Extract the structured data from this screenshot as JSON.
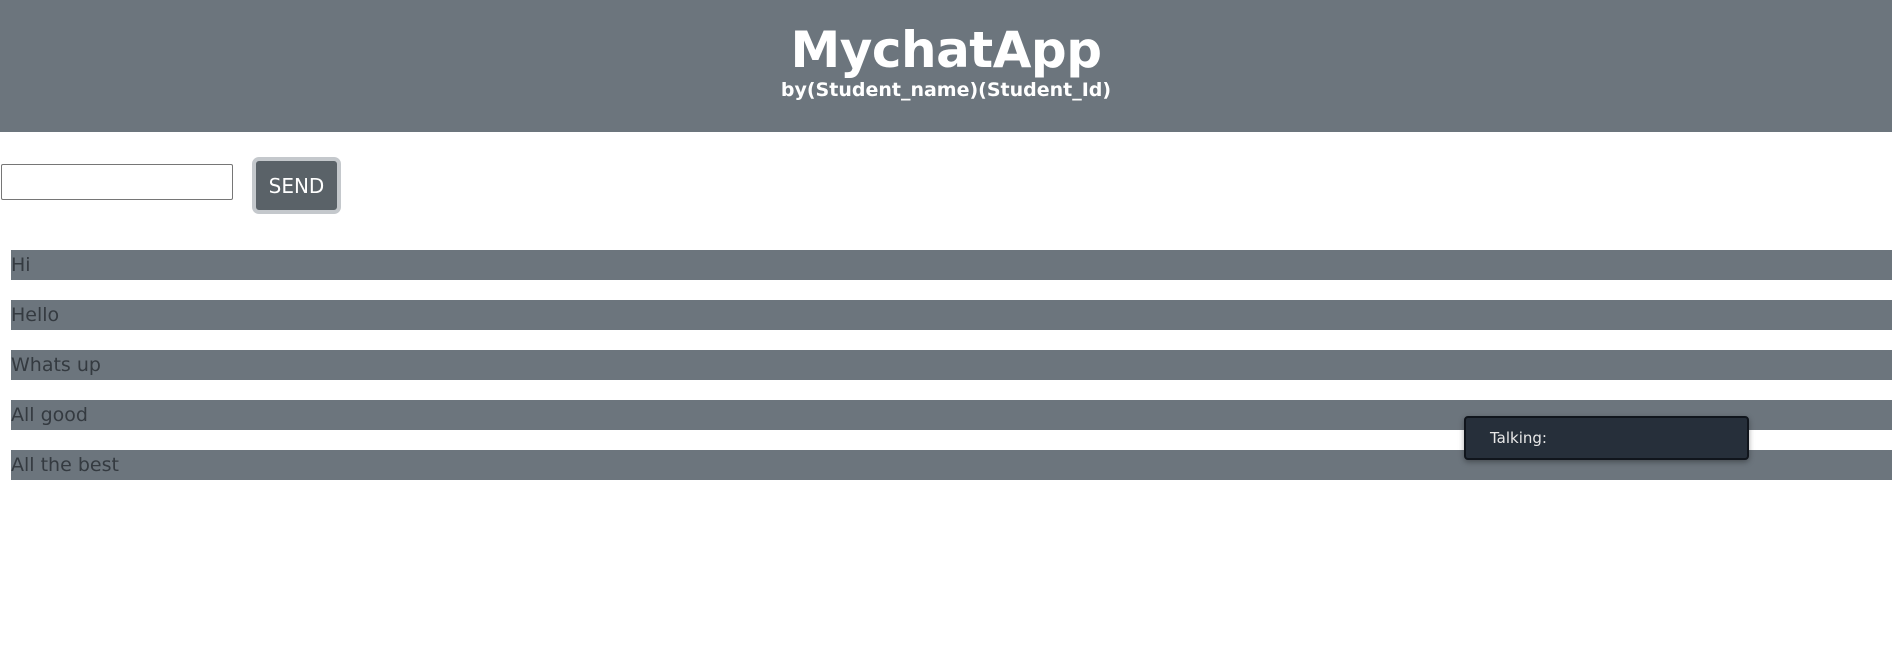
{
  "header": {
    "title": "MychatApp",
    "subtitle": "by(Student_name)(Student_Id)"
  },
  "composer": {
    "input_value": "",
    "input_placeholder": "",
    "send_label": "SEND"
  },
  "messages": [
    {
      "text": "Hi"
    },
    {
      "text": "Hello"
    },
    {
      "text": "Whats up"
    },
    {
      "text": "All good"
    },
    {
      "text": "All the best"
    }
  ],
  "talking_popup": {
    "label": "Talking:"
  },
  "colors": {
    "header_bg": "#6c757d",
    "message_bg": "#6c757d",
    "message_text": "#343a40",
    "send_button_bg": "#5a6268",
    "talking_bg": "#262f3a"
  }
}
